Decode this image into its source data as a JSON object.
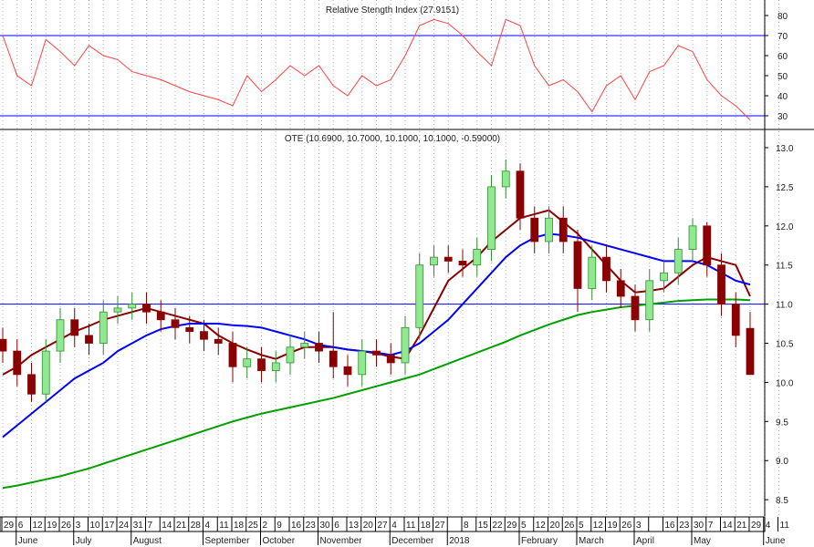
{
  "chart_data": [
    {
      "type": "line",
      "title": "Relative Stength Index",
      "current_value": "(27.9151)",
      "y_ticks": [
        "80",
        "70",
        "60",
        "50",
        "40",
        "30"
      ],
      "ylim": [
        25,
        85
      ],
      "reference_lines": [
        70,
        30
      ],
      "series": [
        {
          "name": "RSI",
          "color": "#ff4040",
          "values": [
            70,
            50,
            45,
            68,
            62,
            55,
            65,
            60,
            58,
            52,
            50,
            48,
            45,
            42,
            40,
            38,
            35,
            50,
            42,
            48,
            55,
            50,
            55,
            45,
            40,
            50,
            45,
            48,
            60,
            75,
            78,
            76,
            70,
            62,
            55,
            78,
            75,
            55,
            45,
            48,
            42,
            32,
            45,
            50,
            38,
            52,
            55,
            65,
            62,
            48,
            40,
            35,
            27.9
          ]
        }
      ]
    },
    {
      "type": "candlestick",
      "title": "OTE",
      "ohlc_label": "(10.6900, 10.7000, 10.1000, 10.1000, -0.59000)",
      "y_ticks": [
        "13.0",
        "12.5",
        "12.0",
        "11.5",
        "11.0",
        "10.5",
        "10.0",
        "9.5",
        "9.0",
        "8.5"
      ],
      "ylim": [
        8.2,
        13.2
      ],
      "reference_line": 11.0,
      "open": [
        10.55,
        10.4,
        10.1,
        9.85,
        10.4,
        10.8,
        10.6,
        10.5,
        10.9,
        10.95,
        11.0,
        10.9,
        10.8,
        10.7,
        10.65,
        10.55,
        10.5,
        10.2,
        10.3,
        10.15,
        10.25,
        10.45,
        10.5,
        10.4,
        10.2,
        10.1,
        10.4,
        10.35,
        10.25,
        10.7,
        11.5,
        11.6,
        11.55,
        11.5,
        11.7,
        12.5,
        12.7,
        12.1,
        11.8,
        12.1,
        11.8,
        11.2,
        11.6,
        11.3,
        11.1,
        10.8,
        11.3,
        11.4,
        11.7,
        12.0,
        11.5,
        11.0,
        10.69
      ],
      "high": [
        10.7,
        10.55,
        10.25,
        10.55,
        10.95,
        10.95,
        10.75,
        11.05,
        11.1,
        11.15,
        11.15,
        11.05,
        10.95,
        10.85,
        10.8,
        10.7,
        10.65,
        10.45,
        10.45,
        10.4,
        10.6,
        10.65,
        10.65,
        10.9,
        10.35,
        10.55,
        10.55,
        10.5,
        10.85,
        11.65,
        11.75,
        11.75,
        11.7,
        11.85,
        12.65,
        12.85,
        12.8,
        12.25,
        12.25,
        12.25,
        11.95,
        11.75,
        11.75,
        11.45,
        11.25,
        11.45,
        11.55,
        11.85,
        12.1,
        12.05,
        11.65,
        11.15,
        10.9
      ],
      "low": [
        10.25,
        9.95,
        9.75,
        9.75,
        10.25,
        10.45,
        10.35,
        10.35,
        10.75,
        10.8,
        10.75,
        10.65,
        10.55,
        10.5,
        10.4,
        10.35,
        10.0,
        10.05,
        10.0,
        10.0,
        10.1,
        10.3,
        10.25,
        10.05,
        9.95,
        9.95,
        10.2,
        10.1,
        10.1,
        10.55,
        11.35,
        11.4,
        11.35,
        11.35,
        11.55,
        12.35,
        11.95,
        11.65,
        11.65,
        11.65,
        10.9,
        11.05,
        11.15,
        10.95,
        10.65,
        10.65,
        11.15,
        11.25,
        11.55,
        11.35,
        10.85,
        10.45,
        10.1
      ],
      "close": [
        10.4,
        10.1,
        9.85,
        10.4,
        10.8,
        10.6,
        10.5,
        10.9,
        10.95,
        11.0,
        10.9,
        10.8,
        10.7,
        10.65,
        10.55,
        10.5,
        10.2,
        10.3,
        10.15,
        10.25,
        10.45,
        10.5,
        10.4,
        10.2,
        10.1,
        10.4,
        10.35,
        10.25,
        10.7,
        11.5,
        11.6,
        11.55,
        11.5,
        11.7,
        12.5,
        12.7,
        12.1,
        11.8,
        12.1,
        11.8,
        11.2,
        11.6,
        11.3,
        11.1,
        10.8,
        11.3,
        11.4,
        11.7,
        12.0,
        11.5,
        11.0,
        10.6,
        10.1
      ],
      "series": [
        {
          "name": "MA short",
          "color": "#8b0000",
          "values": [
            10.1,
            10.2,
            10.35,
            10.45,
            10.55,
            10.65,
            10.72,
            10.8,
            10.85,
            10.9,
            10.95,
            10.9,
            10.85,
            10.8,
            10.75,
            10.6,
            10.5,
            10.42,
            10.35,
            10.3,
            10.38,
            10.45,
            10.45,
            10.45,
            10.42,
            10.4,
            10.37,
            10.33,
            10.3,
            10.6,
            10.95,
            11.3,
            11.45,
            11.6,
            11.8,
            11.95,
            12.1,
            12.15,
            12.2,
            12.05,
            11.9,
            11.7,
            11.5,
            11.3,
            11.15,
            11.17,
            11.2,
            11.35,
            11.5,
            11.6,
            11.55,
            11.5,
            11.1
          ]
        },
        {
          "name": "MA medium",
          "color": "#0000ff",
          "values": [
            9.3,
            9.45,
            9.6,
            9.75,
            9.9,
            10.05,
            10.15,
            10.25,
            10.4,
            10.5,
            10.6,
            10.68,
            10.72,
            10.75,
            10.75,
            10.75,
            10.73,
            10.72,
            10.7,
            10.65,
            10.6,
            10.55,
            10.48,
            10.45,
            10.42,
            10.4,
            10.38,
            10.35,
            10.4,
            10.5,
            10.65,
            10.8,
            11.0,
            11.2,
            11.4,
            11.6,
            11.75,
            11.85,
            11.9,
            11.88,
            11.85,
            11.8,
            11.75,
            11.7,
            11.65,
            11.6,
            11.55,
            11.55,
            11.55,
            11.5,
            11.4,
            11.3,
            11.25
          ]
        },
        {
          "name": "MA long",
          "color": "#00a000",
          "values": [
            8.65,
            8.68,
            8.72,
            8.76,
            8.8,
            8.85,
            8.9,
            8.96,
            9.02,
            9.08,
            9.14,
            9.2,
            9.26,
            9.32,
            9.38,
            9.44,
            9.5,
            9.55,
            9.6,
            9.64,
            9.68,
            9.72,
            9.76,
            9.8,
            9.85,
            9.9,
            9.95,
            10.0,
            10.05,
            10.1,
            10.17,
            10.24,
            10.31,
            10.38,
            10.45,
            10.52,
            10.6,
            10.67,
            10.74,
            10.8,
            10.86,
            10.9,
            10.93,
            10.96,
            10.98,
            11.0,
            11.02,
            11.04,
            11.05,
            11.06,
            11.06,
            11.06,
            11.05
          ]
        }
      ]
    }
  ],
  "x_axis": {
    "week_ticks": [
      "29",
      "6",
      "12",
      "19",
      "26",
      "3",
      "10",
      "17",
      "24",
      "31",
      "7",
      "14",
      "21",
      "28",
      "4",
      "11",
      "18",
      "25",
      "2",
      "9",
      "16",
      "23",
      "30",
      "6",
      "13",
      "20",
      "27",
      "4",
      "11",
      "18",
      "27",
      "",
      "8",
      "15",
      "22",
      "29",
      "5",
      "12",
      "20",
      "26",
      "5",
      "12",
      "19",
      "26",
      "3",
      "",
      "16",
      "23",
      "30",
      "7",
      "14",
      "21",
      "29",
      "4",
      "11"
    ],
    "months": [
      {
        "label": "June",
        "tick": 1
      },
      {
        "label": "July",
        "tick": 5
      },
      {
        "label": "August",
        "tick": 9
      },
      {
        "label": "September",
        "tick": 14
      },
      {
        "label": "October",
        "tick": 18
      },
      {
        "label": "November",
        "tick": 22
      },
      {
        "label": "December",
        "tick": 27
      },
      {
        "label": "2018",
        "tick": 31
      },
      {
        "label": "February",
        "tick": 36
      },
      {
        "label": "March",
        "tick": 40
      },
      {
        "label": "April",
        "tick": 44
      },
      {
        "label": "May",
        "tick": 48
      },
      {
        "label": "June",
        "tick": 53
      }
    ]
  },
  "colors": {
    "up": "#90e890",
    "up_border": "#2f8f2f",
    "down": "#8b0000",
    "ref_line": "#0000ff",
    "grid": "#b0b0b0"
  }
}
